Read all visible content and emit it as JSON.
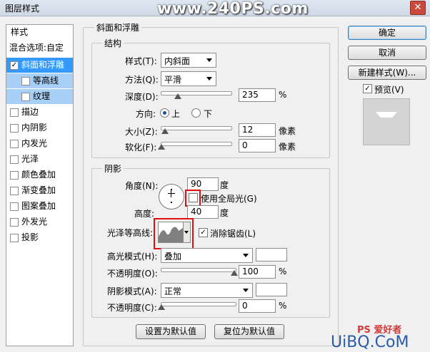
{
  "window": {
    "title": "图层样式",
    "watermark": "www.240PS.com"
  },
  "left_list": {
    "header": "样式",
    "blend": "混合选项:自定",
    "items": [
      {
        "label": "斜面和浮雕",
        "checked": "✓"
      },
      {
        "label": "等高线",
        "checked": ""
      },
      {
        "label": "纹理",
        "checked": ""
      },
      {
        "label": "描边",
        "checked": ""
      },
      {
        "label": "内阴影",
        "checked": ""
      },
      {
        "label": "内发光",
        "checked": ""
      },
      {
        "label": "光泽",
        "checked": ""
      },
      {
        "label": "颜色叠加",
        "checked": ""
      },
      {
        "label": "渐变叠加",
        "checked": ""
      },
      {
        "label": "图案叠加",
        "checked": ""
      },
      {
        "label": "外发光",
        "checked": ""
      },
      {
        "label": "投影",
        "checked": ""
      }
    ]
  },
  "bevel": {
    "title": "斜面和浮雕",
    "structure": {
      "title": "结构",
      "style_label": "样式(T):",
      "style_value": "内斜面",
      "technique_label": "方法(Q):",
      "technique_value": "平滑",
      "depth_label": "深度(D):",
      "depth_value": "235",
      "depth_unit": "%",
      "depth_pct": 0.235,
      "direction_label": "方向:",
      "dir_up": "上",
      "dir_down": "下",
      "size_label": "大小(Z):",
      "size_value": "12",
      "size_unit": "像素",
      "size_pct": 0.048,
      "soften_label": "软化(F):",
      "soften_value": "0",
      "soften_unit": "像素",
      "soften_pct": 0
    },
    "shading": {
      "title": "阴影",
      "angle_label": "角度(N):",
      "angle_value": "90",
      "angle_unit": "度",
      "global_light": "使用全局光(G)",
      "altitude_label": "高度:",
      "altitude_value": "40",
      "altitude_unit": "度",
      "gloss_label": "光泽等高线:",
      "antialias": "消除锯齿(L)",
      "highlight_label": "高光模式(H):",
      "highlight_value": "叠加",
      "hl_opacity_label": "不透明度(O):",
      "hl_opacity_value": "100",
      "hl_opacity_unit": "%",
      "hl_opacity_pct": 1.0,
      "shadow_label": "阴影模式(A):",
      "shadow_value": "正常",
      "sh_opacity_label": "不透明度(C):",
      "sh_opacity_value": "0",
      "sh_opacity_unit": "%",
      "sh_opacity_pct": 0
    },
    "make_default": "设置为默认值",
    "reset_default": "复位为默认值"
  },
  "right": {
    "ok": "确定",
    "cancel": "取消",
    "new_style": "新建样式(W)...",
    "preview": "预览(V)"
  },
  "footer_logo": "UiBQ.CoM",
  "footer_logo2": "PS 爱好者"
}
